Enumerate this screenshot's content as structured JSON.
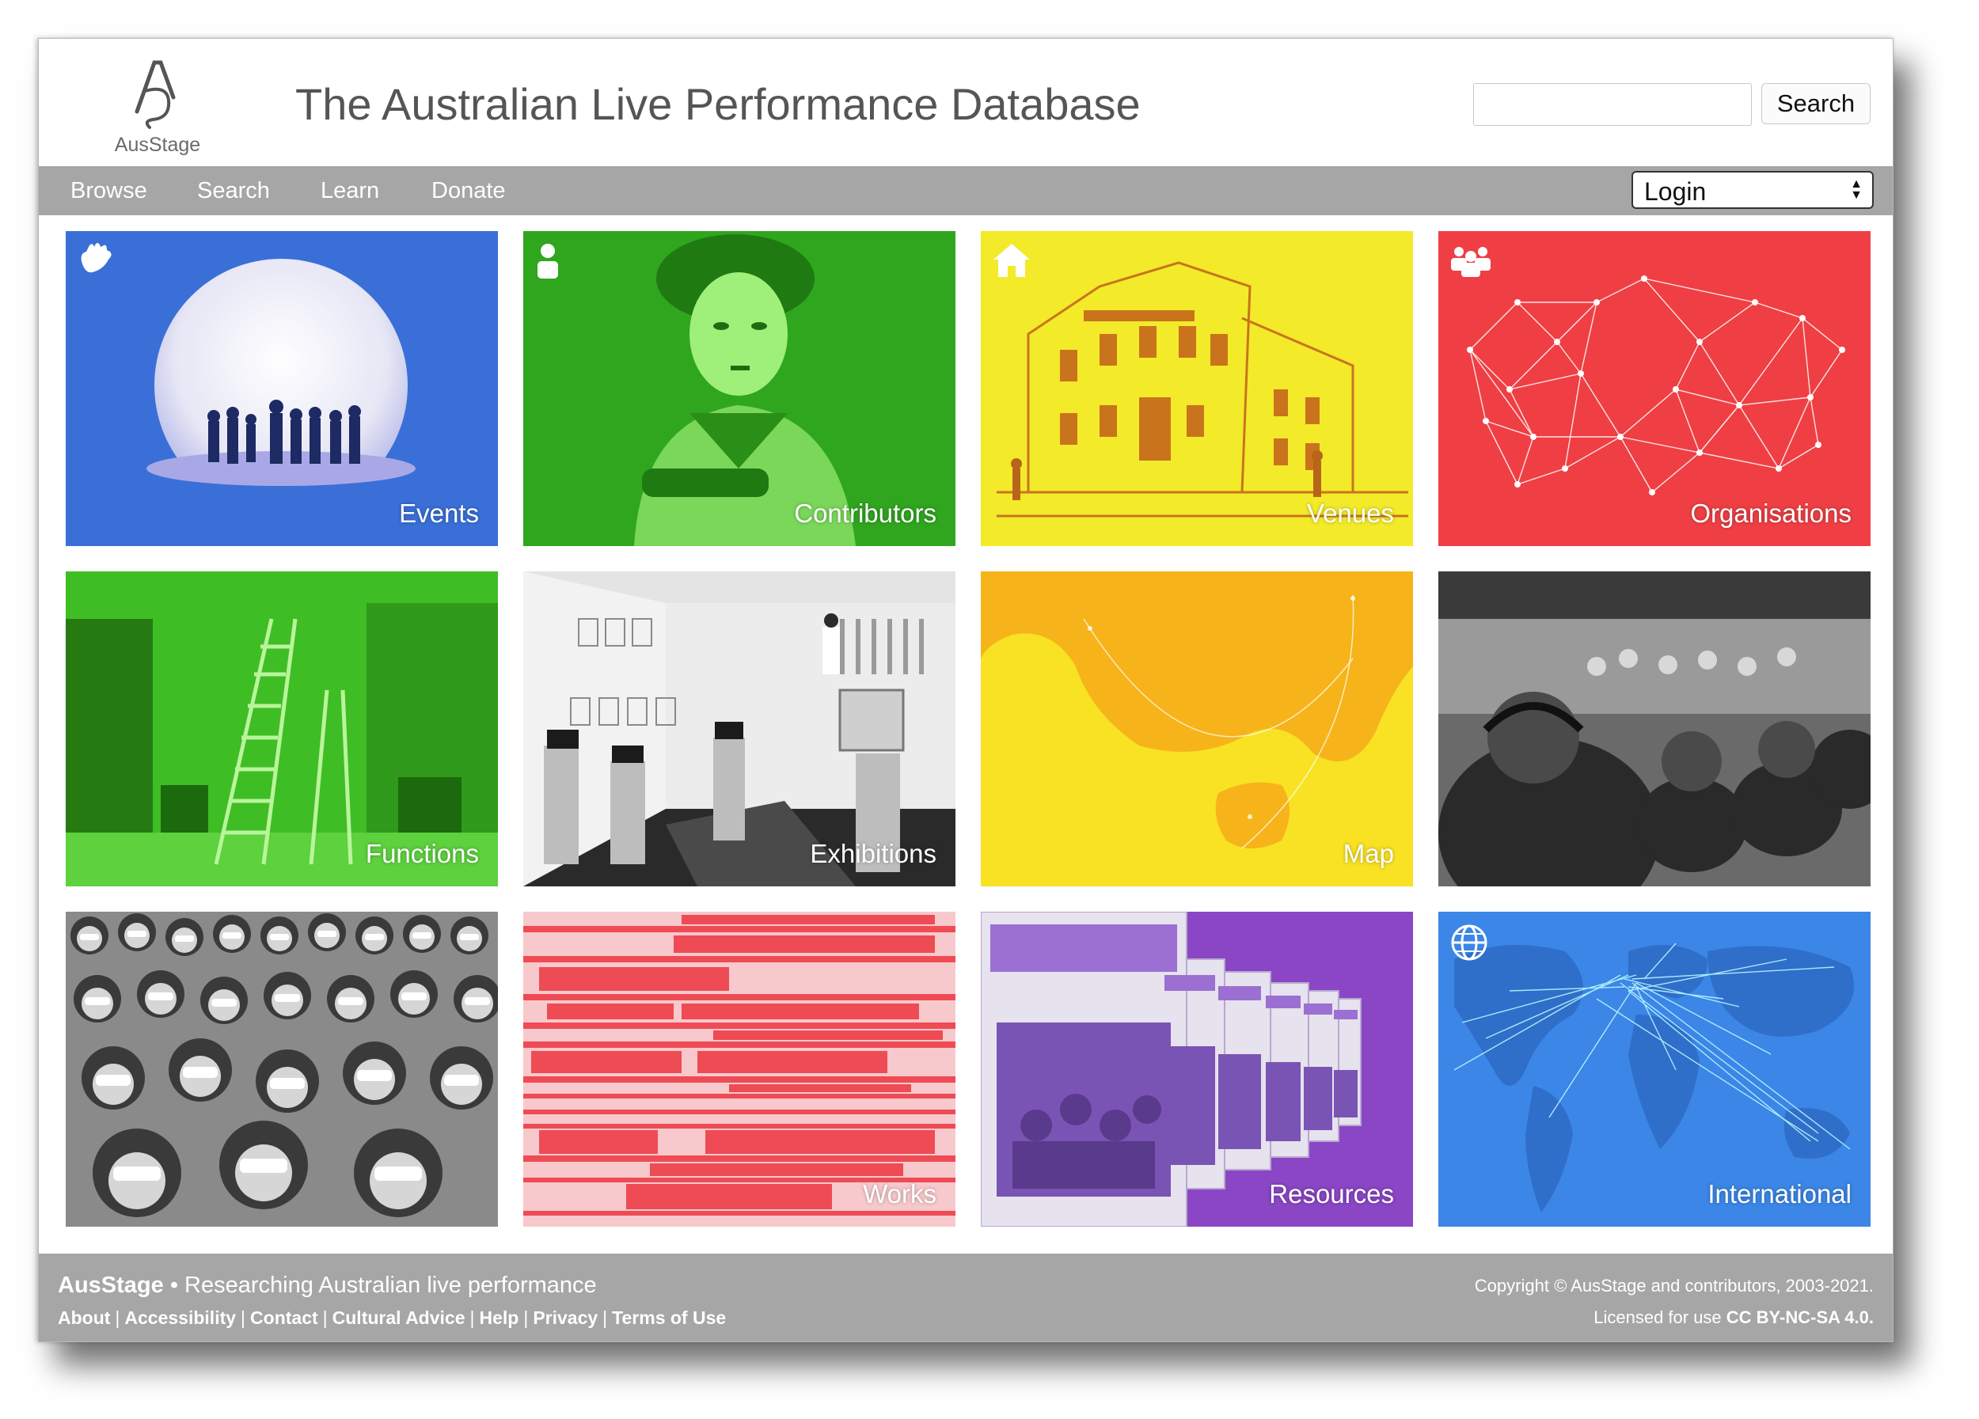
{
  "header": {
    "logo_text": "AusStage",
    "title": "The Australian Live Performance Database",
    "search_placeholder": "",
    "search_button": "Search"
  },
  "nav": {
    "items": [
      {
        "label": "Browse"
      },
      {
        "label": "Search"
      },
      {
        "label": "Learn"
      },
      {
        "label": "Donate"
      }
    ],
    "login": "Login"
  },
  "tiles": [
    {
      "label": "Events",
      "color": "#3a6fd8",
      "icon": "hand-icon"
    },
    {
      "label": "Contributors",
      "color": "#2fa61e",
      "icon": "person-icon"
    },
    {
      "label": "Venues",
      "color": "#f3ea2a",
      "icon": "house-icon"
    },
    {
      "label": "Organisations",
      "color": "#ef3f44",
      "icon": "group-icon"
    },
    {
      "label": "Functions",
      "color": "#3fbd25",
      "icon": ""
    },
    {
      "label": "Exhibitions",
      "color": "#6b6b6b",
      "icon": ""
    },
    {
      "label": "Map",
      "color": "#f8e223",
      "icon": ""
    },
    {
      "label": "",
      "color": "#5a5a5a",
      "icon": ""
    },
    {
      "label": "",
      "color": "#7a7a7a",
      "icon": ""
    },
    {
      "label": "Works",
      "color": "#ee4b55",
      "icon": ""
    },
    {
      "label": "Resources",
      "color": "#8a46c4",
      "icon": ""
    },
    {
      "label": "International",
      "color": "#3b86e6",
      "icon": "globe-icon"
    }
  ],
  "footer": {
    "brand": "AusStage",
    "tagline": " • Researching Australian live performance",
    "links": [
      "About",
      "Accessibility",
      "Contact",
      "Cultural Advice",
      "Help",
      "Privacy",
      "Terms of Use"
    ],
    "copyright": "Copyright © AusStage and contributors, 2003-2021.",
    "license_prefix": "Licensed for use ",
    "license": "CC BY-NC-SA 4.0."
  }
}
